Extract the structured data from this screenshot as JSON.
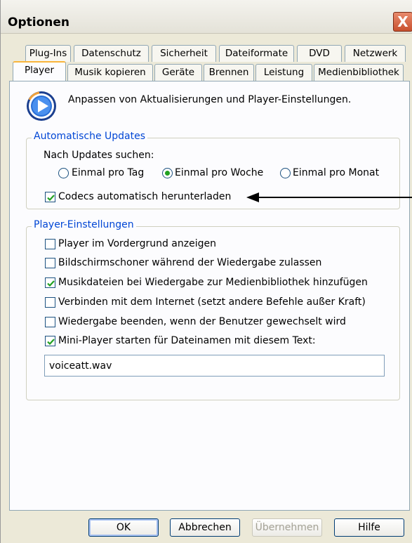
{
  "window": {
    "title": "Optionen",
    "close_symbol": "X"
  },
  "tabs_back": [
    "Plug-Ins",
    "Datenschutz",
    "Sicherheit",
    "Dateiformate",
    "DVD",
    "Netzwerk"
  ],
  "tabs_front": [
    "Player",
    "Musik kopieren",
    "Geräte",
    "Brennen",
    "Leistung",
    "Medienbibliothek"
  ],
  "active_tab": "Player",
  "header": {
    "text": "Anpassen von Aktualisierungen und Player-Einstellungen."
  },
  "updates": {
    "legend": "Automatische Updates",
    "label": "Nach Updates suchen:",
    "options": [
      "Einmal pro Tag",
      "Einmal pro Woche",
      "Einmal pro Monat"
    ],
    "selected": "Einmal pro Woche",
    "codecs_label": "Codecs automatisch herunterladen",
    "codecs_checked": true
  },
  "player_settings": {
    "legend": "Player-Einstellungen",
    "items": [
      {
        "label": "Player im Vordergrund anzeigen",
        "checked": false
      },
      {
        "label": "Bildschirmschoner während der Wiedergabe zulassen",
        "checked": false
      },
      {
        "label": "Musikdateien bei Wiedergabe zur Medienbibliothek hinzufügen",
        "checked": true
      },
      {
        "label": "Verbinden mit dem Internet (setzt andere Befehle außer Kraft)",
        "checked": false
      },
      {
        "label": "Wiedergabe beenden, wenn der Benutzer gewechselt wird",
        "checked": false
      },
      {
        "label": "Mini-Player starten für Dateinamen mit diesem Text:",
        "checked": true
      }
    ],
    "mini_player_text": "voiceatt.wav"
  },
  "buttons": {
    "ok": "OK",
    "cancel": "Abbrechen",
    "apply": "Übernehmen",
    "help": "Hilfe"
  },
  "icons": {
    "app_icon": "media-player-icon",
    "annotation": "arrow-icon"
  },
  "colors": {
    "accent": "#0046d5",
    "check": "#21a121",
    "active_tab_top": "#f9b53b"
  }
}
